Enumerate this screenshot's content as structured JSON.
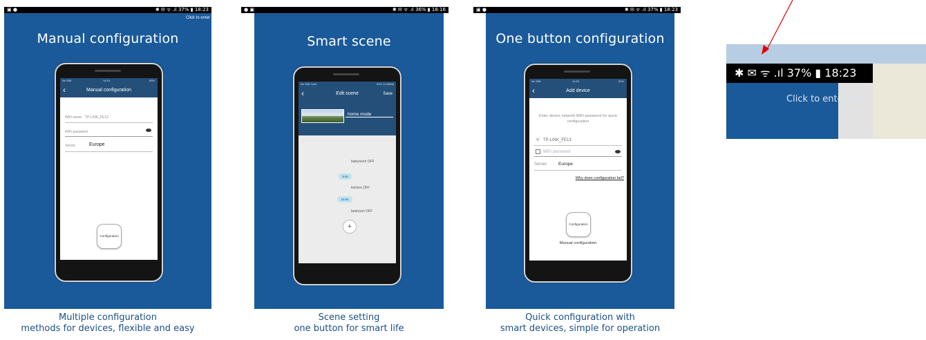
{
  "panels": [
    {
      "status_right": "✱ ✉ ᯤ .ıl 37% ▮ 18:23",
      "click_to_enter": "Click to enter",
      "heading": "Manual configuration",
      "phone": {
        "status_left": "No SIM",
        "status_time": "14:24",
        "status_right": "60%",
        "title": "Manual configuration",
        "wifi_name_label": "WiFi name:",
        "wifi_name_value": "TP-LINK_FE13",
        "wifi_password_placeholder": "WiFi password",
        "server_label": "Server:",
        "server_value": "Europe",
        "config_button": "Configuration"
      },
      "caption_line1": "Multiple configuration",
      "caption_line2": "methods for devices, flexible and easy"
    },
    {
      "status_right": "✱ ✉ ᯤ .ıl 36% ▮ 18:16",
      "heading": "Smart scene",
      "phone": {
        "status_left": "No SIM Card",
        "status_right": "62% 11:36AM",
        "title": "Edit scene",
        "save": "Save",
        "scene_name": "home mode",
        "items": [
          "babyroom OFF",
          "kitchen OFF",
          "bedroom OFF"
        ],
        "delays": [
          "5.0s",
          "10.0s"
        ],
        "add": "+"
      },
      "caption_line1": "Scene setting",
      "caption_line2": "one button for smart life"
    },
    {
      "status_right": "✱ ✉ ᯤ .ıl 37% ▮ 18:23",
      "heading": "One button configuration",
      "phone": {
        "status_left": "No SIM",
        "status_time": "14:23",
        "status_right": "61%",
        "title": "Add device",
        "instruction": "Enter device network WiFi password for quick configuration",
        "wifi_name_value": "TP-LINK_FE13",
        "wifi_password_placeholder": "WiFi password",
        "server_label": "Server:",
        "server_value": "Europe",
        "why_fail": "Why does configuration fail?",
        "config_button": "Configuration",
        "manual_link": "Manual configuration"
      },
      "caption_line1": "Quick configuration with",
      "caption_line2": "smart devices, simple for operation"
    }
  ],
  "inset": {
    "status": "✱ ✉ ᯤ .ıl 37% ▮ 18:23",
    "click_to_enter": "Click to enter >>"
  },
  "colors": {
    "blue_bg": "#1a5a9a",
    "app_bar": "#244f79",
    "caption": "#1b4f86",
    "arrow": "#e00000"
  }
}
